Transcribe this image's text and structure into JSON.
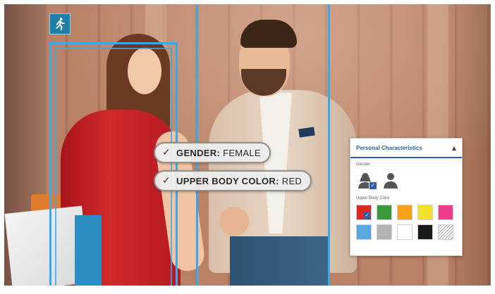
{
  "tags": {
    "gender": {
      "key": "GENDER:",
      "value": "FEMALE"
    },
    "upper_body_color": {
      "key": "UPPER BODY COLOR:",
      "value": "RED"
    }
  },
  "panel": {
    "title": "Personal Characteristics",
    "gender_label": "Gender",
    "gender_selected": "female",
    "upper_body_color_label": "Upper Body Color",
    "selected_color": "red",
    "colors": [
      "#e02727",
      "#3a9a3a",
      "#f5a21a",
      "#f3e02a",
      "#ee3e8b",
      "#5aa6de",
      "#b3b3b3",
      "#ffffff",
      "#1a1a1a",
      "striped"
    ]
  },
  "icons": {
    "person_walking": "person-walking-icon",
    "check": "check-icon",
    "collapse": "chevron-up-icon",
    "female": "female-avatar-icon",
    "male": "male-avatar-icon"
  },
  "accent_color": "#39a9e8"
}
